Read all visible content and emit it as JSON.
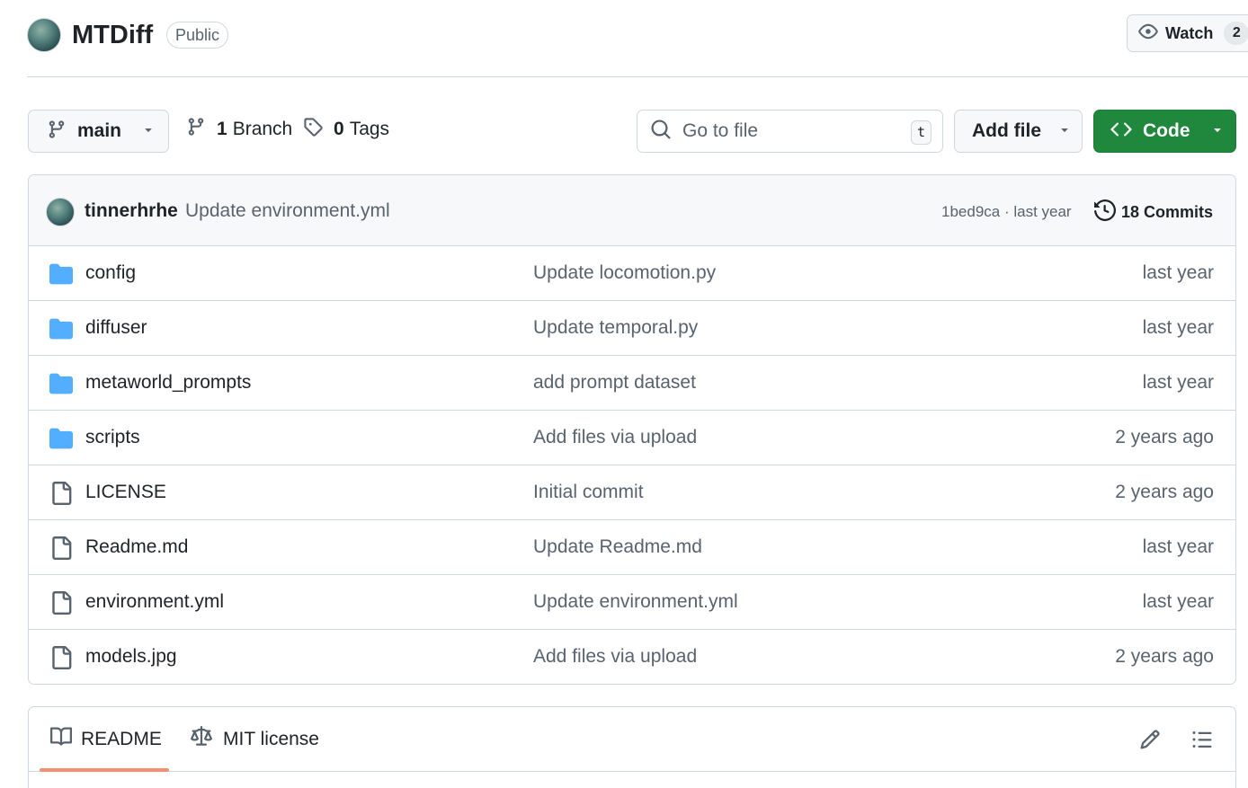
{
  "repo": {
    "name": "MTDiff",
    "visibility": "Public"
  },
  "watch": {
    "label": "Watch",
    "count": "2"
  },
  "toolbar": {
    "branch": "main",
    "branches_count": "1",
    "branches_label": "Branch",
    "tags_count": "0",
    "tags_label": "Tags",
    "search_placeholder": "Go to file",
    "search_shortcut": "t",
    "add_file_label": "Add file",
    "code_label": "Code"
  },
  "latest_commit": {
    "author": "tinnerhrhe",
    "message": "Update environment.yml",
    "sha_and_time": "1bed9ca · last year",
    "commits_label": "18 Commits"
  },
  "files": [
    {
      "name": "config",
      "type": "folder",
      "message": "Update locomotion.py",
      "date": "last year"
    },
    {
      "name": "diffuser",
      "type": "folder",
      "message": "Update temporal.py",
      "date": "last year"
    },
    {
      "name": "metaworld_prompts",
      "type": "folder",
      "message": "add prompt dataset",
      "date": "last year"
    },
    {
      "name": "scripts",
      "type": "folder",
      "message": "Add files via upload",
      "date": "2 years ago"
    },
    {
      "name": "LICENSE",
      "type": "file",
      "message": "Initial commit",
      "date": "2 years ago"
    },
    {
      "name": "Readme.md",
      "type": "file",
      "message": "Update Readme.md",
      "date": "last year"
    },
    {
      "name": "environment.yml",
      "type": "file",
      "message": "Update environment.yml",
      "date": "last year"
    },
    {
      "name": "models.jpg",
      "type": "file",
      "message": "Add files via upload",
      "date": "2 years ago"
    }
  ],
  "readme": {
    "tab_readme": "README",
    "tab_license": "MIT license"
  },
  "colors": {
    "accent_green": "#1f883d",
    "folder_blue": "#54aeff",
    "tab_underline": "#fd8c73"
  }
}
